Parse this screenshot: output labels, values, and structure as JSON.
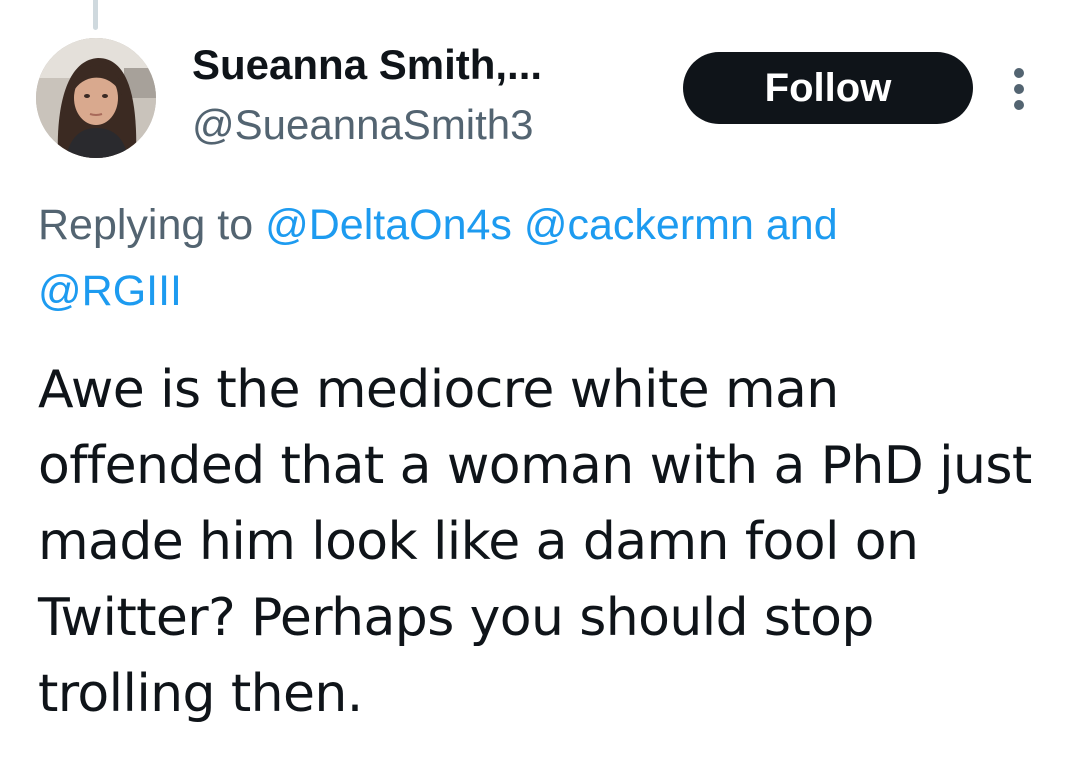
{
  "author": {
    "display_name": "Sueanna Smith,...",
    "handle": "@SueannaSmith3"
  },
  "actions": {
    "follow_label": "Follow",
    "more_icon": "vertical-ellipsis-icon"
  },
  "reply_context": {
    "prefix": "Replying to",
    "mentions": [
      "@DeltaOn4s",
      "@cackermn",
      "@RGIII"
    ],
    "conjunction": "and"
  },
  "tweet": {
    "text": "Awe is the mediocre white man offended that a woman with a PhD just made him look like a damn fool on Twitter? Perhaps you should stop trolling then."
  },
  "colors": {
    "text_primary": "#0f1419",
    "text_secondary": "#536471",
    "link": "#1d9bf0",
    "follow_button_bg": "#0f1419",
    "thread_line": "#cfd9de"
  }
}
